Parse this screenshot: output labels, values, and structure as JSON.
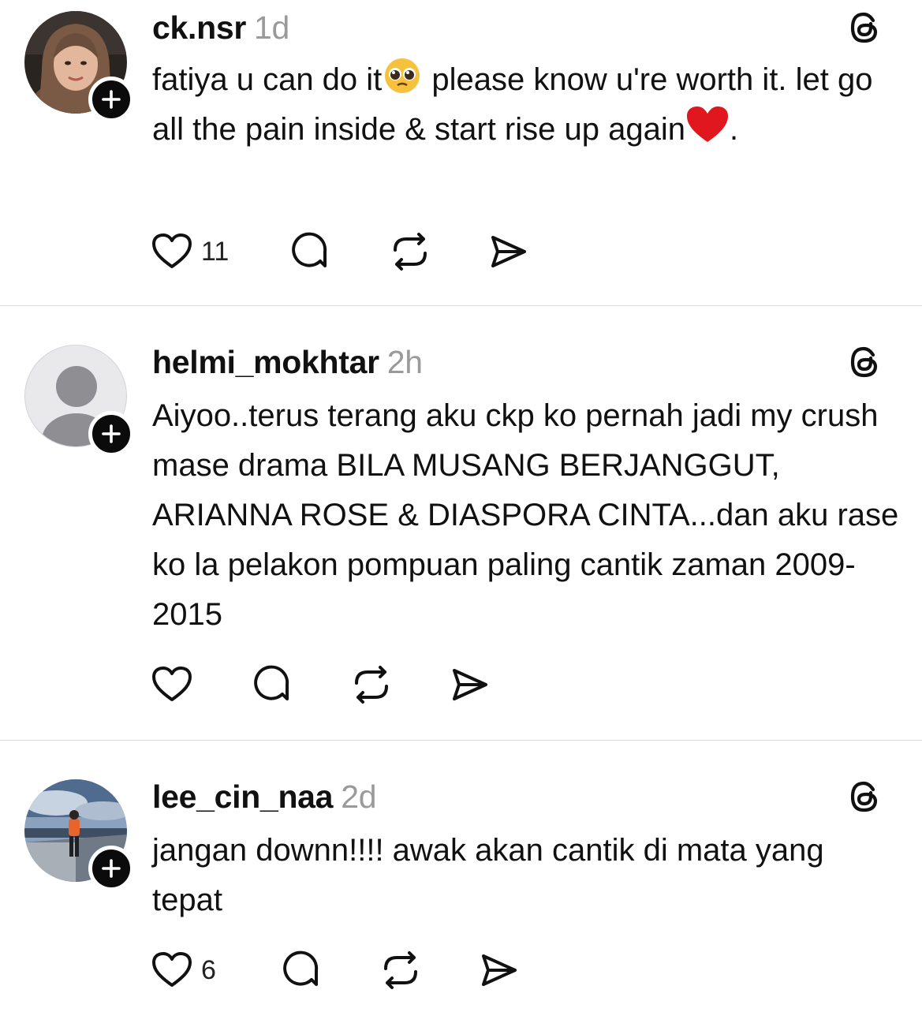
{
  "posts": [
    {
      "username": "ck.nsr",
      "time": "1d",
      "text_before": "fatiya u can do it",
      "text_middle": " please know u're worth it. let go all the pain inside & start rise up again",
      "text_after": ".",
      "emojis": [
        "pleading-face-emoji",
        "red-heart-emoji"
      ],
      "likes": "11"
    },
    {
      "username": "helmi_mokhtar",
      "time": "2h",
      "text": "Aiyoo..terus terang aku ckp ko pernah jadi my crush mase drama BILA MUSANG BERJANGGUT, ARIANNA ROSE & DIASPORA CINTA...dan aku rase ko la pelakon pompuan paling cantik zaman 2009-2015",
      "likes": ""
    },
    {
      "username": "lee_cin_naa",
      "time": "2d",
      "text": "jangan downn!!!! awak akan cantik di mata yang tepat",
      "likes": "6"
    }
  ],
  "icons": [
    "heart-icon",
    "reply-icon",
    "repost-icon",
    "share-icon",
    "threads-logo-icon",
    "plus-icon"
  ],
  "colors": {
    "text": "#111111",
    "muted": "#9a9a9a",
    "divider": "#dcdcdc",
    "follow_badge": "#0b0b0b"
  }
}
